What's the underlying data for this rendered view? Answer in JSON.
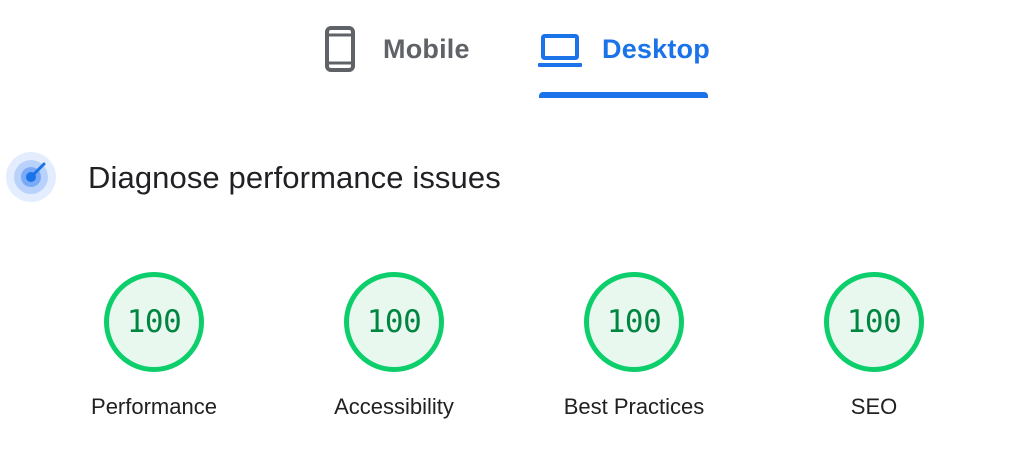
{
  "tabs": [
    {
      "label": "Mobile",
      "active": false
    },
    {
      "label": "Desktop",
      "active": true
    }
  ],
  "section": {
    "title": "Diagnose performance issues",
    "icon": "performance-gauge-icon"
  },
  "categories": [
    {
      "score": "100",
      "label": "Performance"
    },
    {
      "score": "100",
      "label": "Accessibility"
    },
    {
      "score": "100",
      "label": "Best Practices"
    },
    {
      "score": "100",
      "label": "SEO"
    }
  ],
  "colors": {
    "accent": "#1a73e8",
    "inactive_tab": "#5f6368",
    "pass_ring": "#0cce6b",
    "pass_fill": "#e8f8ee",
    "pass_text": "#018642"
  }
}
